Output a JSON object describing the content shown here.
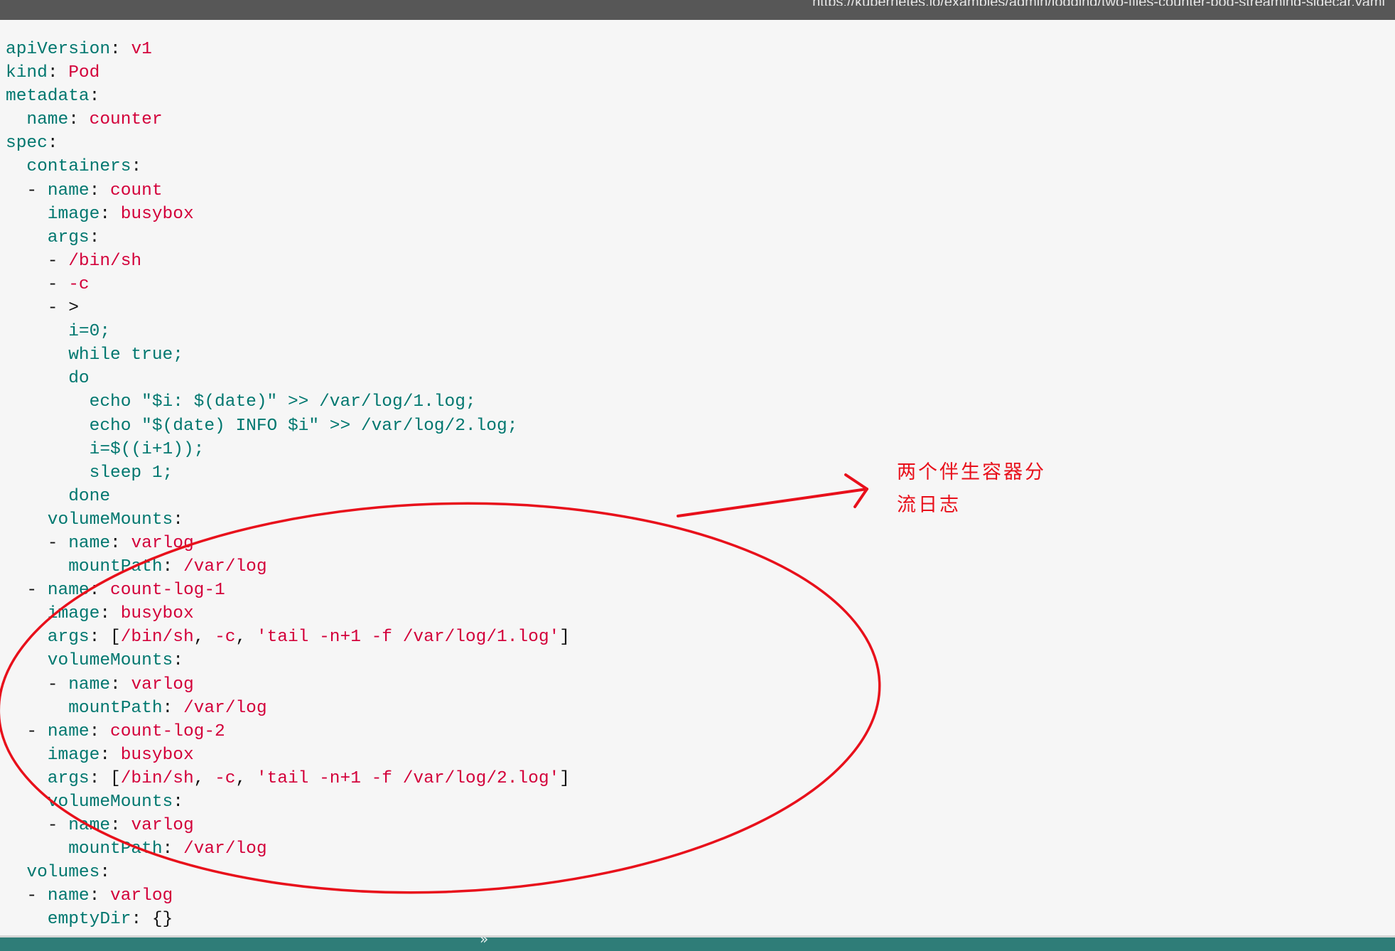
{
  "header": {
    "link_text": "https://kubernetes.io/examples/admin/logging/two-files-counter-pod-streaming-sidecar.yaml"
  },
  "code_lines": [
    [
      {
        "t": "apiVersion",
        "c": "k"
      },
      {
        "t": ": ",
        "c": "p"
      },
      {
        "t": "v1",
        "c": "v"
      }
    ],
    [
      {
        "t": "kind",
        "c": "k"
      },
      {
        "t": ": ",
        "c": "p"
      },
      {
        "t": "Pod",
        "c": "v"
      }
    ],
    [
      {
        "t": "metadata",
        "c": "k"
      },
      {
        "t": ":",
        "c": "p"
      }
    ],
    [
      {
        "t": "  name",
        "c": "k"
      },
      {
        "t": ": ",
        "c": "p"
      },
      {
        "t": "counter",
        "c": "v"
      }
    ],
    [
      {
        "t": "spec",
        "c": "k"
      },
      {
        "t": ":",
        "c": "p"
      }
    ],
    [
      {
        "t": "  containers",
        "c": "k"
      },
      {
        "t": ":",
        "c": "p"
      }
    ],
    [
      {
        "t": "  - ",
        "c": "p"
      },
      {
        "t": "name",
        "c": "k"
      },
      {
        "t": ": ",
        "c": "p"
      },
      {
        "t": "count",
        "c": "v"
      }
    ],
    [
      {
        "t": "    image",
        "c": "k"
      },
      {
        "t": ": ",
        "c": "p"
      },
      {
        "t": "busybox",
        "c": "v"
      }
    ],
    [
      {
        "t": "    args",
        "c": "k"
      },
      {
        "t": ":",
        "c": "p"
      }
    ],
    [
      {
        "t": "    - ",
        "c": "p"
      },
      {
        "t": "/bin/sh",
        "c": "v"
      }
    ],
    [
      {
        "t": "    - ",
        "c": "p"
      },
      {
        "t": "-c",
        "c": "v"
      }
    ],
    [
      {
        "t": "    - ",
        "c": "p"
      },
      {
        "t": ">",
        "c": "p"
      }
    ],
    [
      {
        "t": "      i=0;",
        "c": "k"
      }
    ],
    [
      {
        "t": "      while true;",
        "c": "k"
      }
    ],
    [
      {
        "t": "      do",
        "c": "k"
      }
    ],
    [
      {
        "t": "        echo \"$i: $(date)\" >> /var/log/1.log;",
        "c": "k"
      }
    ],
    [
      {
        "t": "        echo \"$(date) INFO $i\" >> /var/log/2.log;",
        "c": "k"
      }
    ],
    [
      {
        "t": "        i=$((i+1));",
        "c": "k"
      }
    ],
    [
      {
        "t": "        sleep 1;",
        "c": "k"
      }
    ],
    [
      {
        "t": "      done",
        "c": "k"
      }
    ],
    [
      {
        "t": "    volumeMounts",
        "c": "k"
      },
      {
        "t": ":",
        "c": "p"
      }
    ],
    [
      {
        "t": "    - ",
        "c": "p"
      },
      {
        "t": "name",
        "c": "k"
      },
      {
        "t": ": ",
        "c": "p"
      },
      {
        "t": "varlog",
        "c": "v"
      }
    ],
    [
      {
        "t": "      mountPath",
        "c": "k"
      },
      {
        "t": ": ",
        "c": "p"
      },
      {
        "t": "/var/log",
        "c": "v"
      }
    ],
    [
      {
        "t": "  - ",
        "c": "p"
      },
      {
        "t": "name",
        "c": "k"
      },
      {
        "t": ": ",
        "c": "p"
      },
      {
        "t": "count-log-1",
        "c": "v"
      }
    ],
    [
      {
        "t": "    image",
        "c": "k"
      },
      {
        "t": ": ",
        "c": "p"
      },
      {
        "t": "busybox",
        "c": "v"
      }
    ],
    [
      {
        "t": "    args",
        "c": "k"
      },
      {
        "t": ": [",
        "c": "p"
      },
      {
        "t": "/bin/sh",
        "c": "v"
      },
      {
        "t": ", ",
        "c": "p"
      },
      {
        "t": "-c",
        "c": "v"
      },
      {
        "t": ", ",
        "c": "p"
      },
      {
        "t": "'tail -n+1 -f /var/log/1.log'",
        "c": "v"
      },
      {
        "t": "]",
        "c": "p"
      }
    ],
    [
      {
        "t": "    volumeMounts",
        "c": "k"
      },
      {
        "t": ":",
        "c": "p"
      }
    ],
    [
      {
        "t": "    - ",
        "c": "p"
      },
      {
        "t": "name",
        "c": "k"
      },
      {
        "t": ": ",
        "c": "p"
      },
      {
        "t": "varlog",
        "c": "v"
      }
    ],
    [
      {
        "t": "      mountPath",
        "c": "k"
      },
      {
        "t": ": ",
        "c": "p"
      },
      {
        "t": "/var/log",
        "c": "v"
      }
    ],
    [
      {
        "t": "  - ",
        "c": "p"
      },
      {
        "t": "name",
        "c": "k"
      },
      {
        "t": ": ",
        "c": "p"
      },
      {
        "t": "count-log-2",
        "c": "v"
      }
    ],
    [
      {
        "t": "    image",
        "c": "k"
      },
      {
        "t": ": ",
        "c": "p"
      },
      {
        "t": "busybox",
        "c": "v"
      }
    ],
    [
      {
        "t": "    args",
        "c": "k"
      },
      {
        "t": ": [",
        "c": "p"
      },
      {
        "t": "/bin/sh",
        "c": "v"
      },
      {
        "t": ", ",
        "c": "p"
      },
      {
        "t": "-c",
        "c": "v"
      },
      {
        "t": ", ",
        "c": "p"
      },
      {
        "t": "'tail -n+1 -f /var/log/2.log'",
        "c": "v"
      },
      {
        "t": "]",
        "c": "p"
      }
    ],
    [
      {
        "t": "    volumeMounts",
        "c": "k"
      },
      {
        "t": ":",
        "c": "p"
      }
    ],
    [
      {
        "t": "    - ",
        "c": "p"
      },
      {
        "t": "name",
        "c": "k"
      },
      {
        "t": ": ",
        "c": "p"
      },
      {
        "t": "varlog",
        "c": "v"
      }
    ],
    [
      {
        "t": "      mountPath",
        "c": "k"
      },
      {
        "t": ": ",
        "c": "p"
      },
      {
        "t": "/var/log",
        "c": "v"
      }
    ],
    [
      {
        "t": "  volumes",
        "c": "k"
      },
      {
        "t": ":",
        "c": "p"
      }
    ],
    [
      {
        "t": "  - ",
        "c": "p"
      },
      {
        "t": "name",
        "c": "k"
      },
      {
        "t": ": ",
        "c": "p"
      },
      {
        "t": "varlog",
        "c": "v"
      }
    ],
    [
      {
        "t": "    emptyDir",
        "c": "k"
      },
      {
        "t": ": {}",
        "c": "p"
      }
    ]
  ],
  "annotation": {
    "line1": "两个伴生容器分",
    "line2": "流日志",
    "color": "#e8101b"
  },
  "footer": {
    "chevron": "»"
  },
  "colors": {
    "key": "#00776f",
    "value": "#d3003a",
    "plain": "#111111",
    "page_bg": "#f6f6f6"
  }
}
